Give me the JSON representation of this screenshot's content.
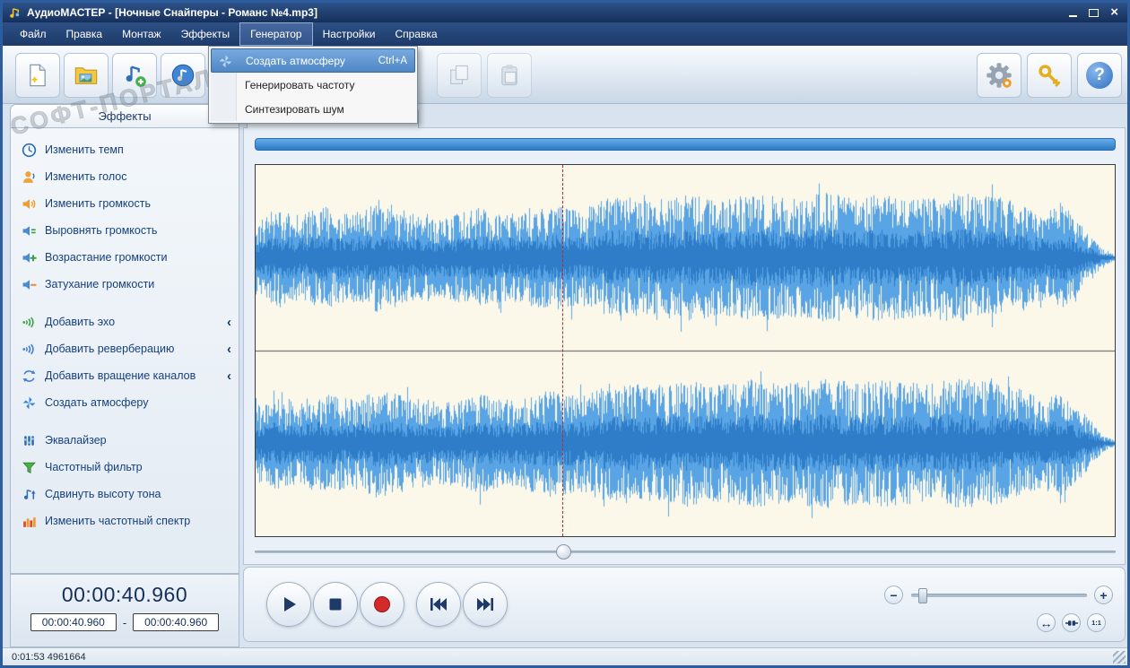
{
  "window": {
    "title": "АудиоМАСТЕР - [Ночные Снайперы - Романс №4.mp3]",
    "close_glyph": "×"
  },
  "watermark": "СОФТ-ПОРТАЛ",
  "menu": {
    "items": [
      "Файл",
      "Правка",
      "Монтаж",
      "Эффекты",
      "Генератор",
      "Настройки",
      "Справка"
    ]
  },
  "generator_menu": {
    "items": [
      {
        "label": "Создать атмосферу",
        "shortcut": "Ctrl+A"
      },
      {
        "label": "Генерировать частоту",
        "shortcut": ""
      },
      {
        "label": "Синтезировать шум",
        "shortcut": ""
      }
    ]
  },
  "toolbar": {
    "help_glyph": "?"
  },
  "sidebar": {
    "tab": "Эффекты",
    "chevron": "‹",
    "items": [
      "Изменить темп",
      "Изменить голос",
      "Изменить громкость",
      "Выровнять громкость",
      "Возрастание громкости",
      "Затухание громкости",
      "Добавить эхо",
      "Добавить реверберацию",
      "Добавить вращение каналов",
      "Создать атмосферу",
      "Эквалайзер",
      "Частотный фильтр",
      "Сдвинуть высоту тона",
      "Изменить частотный спектр"
    ]
  },
  "time": {
    "current": "00:00:40.960",
    "sel_start": "00:00:40.960",
    "sel_end": "00:00:40.960",
    "separator": "-"
  },
  "zoom": {
    "minus": "−",
    "plus": "+",
    "fit_glyph": "↔",
    "one_to_one": "1:1"
  },
  "status": {
    "text": "0:01:53 4961664"
  },
  "colors": {
    "waveform": "#58a4e4",
    "waveform_core": "#2f7cc8",
    "waveform_bg": "#fcf8e9",
    "playhead": "#cc2020",
    "accent_blue": "#2f7ac6"
  }
}
